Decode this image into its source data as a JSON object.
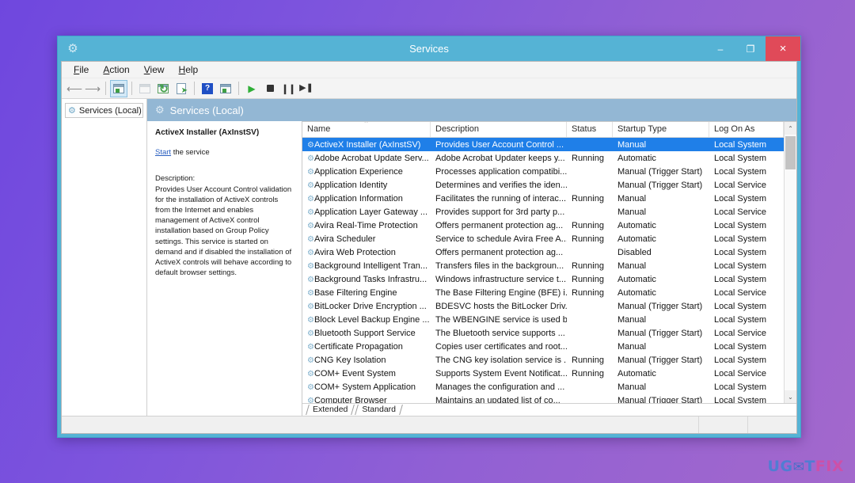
{
  "window": {
    "title": "Services",
    "title_icon": "gear-icon",
    "buttons": {
      "minimize": "–",
      "maximize": "❐",
      "close": "×"
    }
  },
  "menubar": [
    {
      "label": "File",
      "accel": "F"
    },
    {
      "label": "Action",
      "accel": "A"
    },
    {
      "label": "View",
      "accel": "V"
    },
    {
      "label": "Help",
      "accel": "H"
    }
  ],
  "toolbar": [
    {
      "name": "back-icon",
      "glyph": "⬅"
    },
    {
      "name": "forward-icon",
      "glyph": "➡"
    },
    {
      "name": "separator-1",
      "glyph": ""
    },
    {
      "name": "show-hide-tree-icon",
      "glyph": ""
    },
    {
      "name": "separator-2",
      "glyph": ""
    },
    {
      "name": "properties-icon",
      "glyph": ""
    },
    {
      "name": "refresh-icon",
      "glyph": "↻"
    },
    {
      "name": "export-list-icon",
      "glyph": ""
    },
    {
      "name": "separator-3",
      "glyph": ""
    },
    {
      "name": "help-icon",
      "glyph": "?"
    },
    {
      "name": "new-window-icon",
      "glyph": ""
    },
    {
      "name": "separator-4",
      "glyph": ""
    },
    {
      "name": "start-service-icon",
      "glyph": "▶"
    },
    {
      "name": "stop-service-icon",
      "glyph": ""
    },
    {
      "name": "pause-service-icon",
      "glyph": "❙❙"
    },
    {
      "name": "restart-service-icon",
      "glyph": "▶❘"
    }
  ],
  "tree": {
    "root_label": "Services (Local)",
    "icon": "gear-icon"
  },
  "content_header": {
    "title": "Services (Local)",
    "icon": "gear-icon"
  },
  "detail": {
    "service_title": "ActiveX Installer (AxInstSV)",
    "action_link": "Start",
    "action_suffix": " the service",
    "description_label": "Description:",
    "description": "Provides User Account Control validation for the installation of ActiveX controls from the Internet and enables management of ActiveX control installation based on Group Policy settings. This service is started on demand and if disabled the installation of ActiveX controls will behave according to default browser settings."
  },
  "list": {
    "columns": [
      {
        "key": "name",
        "label": "Name",
        "sorted": true
      },
      {
        "key": "desc",
        "label": "Description",
        "sorted": false
      },
      {
        "key": "status",
        "label": "Status",
        "sorted": false
      },
      {
        "key": "startup",
        "label": "Startup Type",
        "sorted": false
      },
      {
        "key": "logon",
        "label": "Log On As",
        "sorted": false
      }
    ],
    "sort_caret": "⌃",
    "rows": [
      {
        "name": "ActiveX Installer (AxInstSV)",
        "desc": "Provides User Account Control ...",
        "status": "",
        "startup": "Manual",
        "logon": "Local System",
        "selected": true
      },
      {
        "name": "Adobe Acrobat Update Serv...",
        "desc": "Adobe Acrobat Updater keeps y...",
        "status": "Running",
        "startup": "Automatic",
        "logon": "Local System",
        "selected": false
      },
      {
        "name": "Application Experience",
        "desc": "Processes application compatibi...",
        "status": "",
        "startup": "Manual (Trigger Start)",
        "logon": "Local System",
        "selected": false
      },
      {
        "name": "Application Identity",
        "desc": "Determines and verifies the iden...",
        "status": "",
        "startup": "Manual (Trigger Start)",
        "logon": "Local Service",
        "selected": false
      },
      {
        "name": "Application Information",
        "desc": "Facilitates the running of interac...",
        "status": "Running",
        "startup": "Manual",
        "logon": "Local System",
        "selected": false
      },
      {
        "name": "Application Layer Gateway ...",
        "desc": "Provides support for 3rd party p...",
        "status": "",
        "startup": "Manual",
        "logon": "Local Service",
        "selected": false
      },
      {
        "name": "Avira Real-Time Protection",
        "desc": "Offers permanent protection ag...",
        "status": "Running",
        "startup": "Automatic",
        "logon": "Local System",
        "selected": false
      },
      {
        "name": "Avira Scheduler",
        "desc": "Service to schedule Avira Free A...",
        "status": "Running",
        "startup": "Automatic",
        "logon": "Local System",
        "selected": false
      },
      {
        "name": "Avira Web Protection",
        "desc": "Offers permanent protection ag...",
        "status": "",
        "startup": "Disabled",
        "logon": "Local System",
        "selected": false
      },
      {
        "name": "Background Intelligent Tran...",
        "desc": "Transfers files in the backgroun...",
        "status": "Running",
        "startup": "Manual",
        "logon": "Local System",
        "selected": false
      },
      {
        "name": "Background Tasks Infrastru...",
        "desc": "Windows infrastructure service t...",
        "status": "Running",
        "startup": "Automatic",
        "logon": "Local System",
        "selected": false
      },
      {
        "name": "Base Filtering Engine",
        "desc": "The Base Filtering Engine (BFE) i...",
        "status": "Running",
        "startup": "Automatic",
        "logon": "Local Service",
        "selected": false
      },
      {
        "name": "BitLocker Drive Encryption ...",
        "desc": "BDESVC hosts the BitLocker Driv...",
        "status": "",
        "startup": "Manual (Trigger Start)",
        "logon": "Local System",
        "selected": false
      },
      {
        "name": "Block Level Backup Engine ...",
        "desc": "The WBENGINE service is used b...",
        "status": "",
        "startup": "Manual",
        "logon": "Local System",
        "selected": false
      },
      {
        "name": "Bluetooth Support Service",
        "desc": "The Bluetooth service supports ...",
        "status": "",
        "startup": "Manual (Trigger Start)",
        "logon": "Local Service",
        "selected": false
      },
      {
        "name": "Certificate Propagation",
        "desc": "Copies user certificates and root...",
        "status": "",
        "startup": "Manual",
        "logon": "Local System",
        "selected": false
      },
      {
        "name": "CNG Key Isolation",
        "desc": "The CNG key isolation service is ...",
        "status": "Running",
        "startup": "Manual (Trigger Start)",
        "logon": "Local System",
        "selected": false
      },
      {
        "name": "COM+ Event System",
        "desc": "Supports System Event Notificat...",
        "status": "Running",
        "startup": "Automatic",
        "logon": "Local Service",
        "selected": false
      },
      {
        "name": "COM+ System Application",
        "desc": "Manages the configuration and ...",
        "status": "",
        "startup": "Manual",
        "logon": "Local System",
        "selected": false
      },
      {
        "name": "Computer Browser",
        "desc": "Maintains an updated list of co...",
        "status": "",
        "startup": "Manual (Trigger Start)",
        "logon": "Local System",
        "selected": false
      }
    ],
    "row_icon": "gear-icon",
    "scrollbar": {
      "up_arrow": "⌃",
      "down_arrow": "⌄"
    }
  },
  "tabs": [
    {
      "label": "Extended",
      "active": false
    },
    {
      "label": "Standard",
      "active": true
    }
  ],
  "watermark": {
    "part1": "UG",
    "part2": "✉",
    "part3": "T",
    "part4": "FIX"
  },
  "colors": {
    "accent_selection": "#1f7fe8",
    "window_frame": "#55b3d5",
    "close_button": "#e04a59",
    "content_header": "#93b7d4",
    "link": "#2a5fc0"
  }
}
